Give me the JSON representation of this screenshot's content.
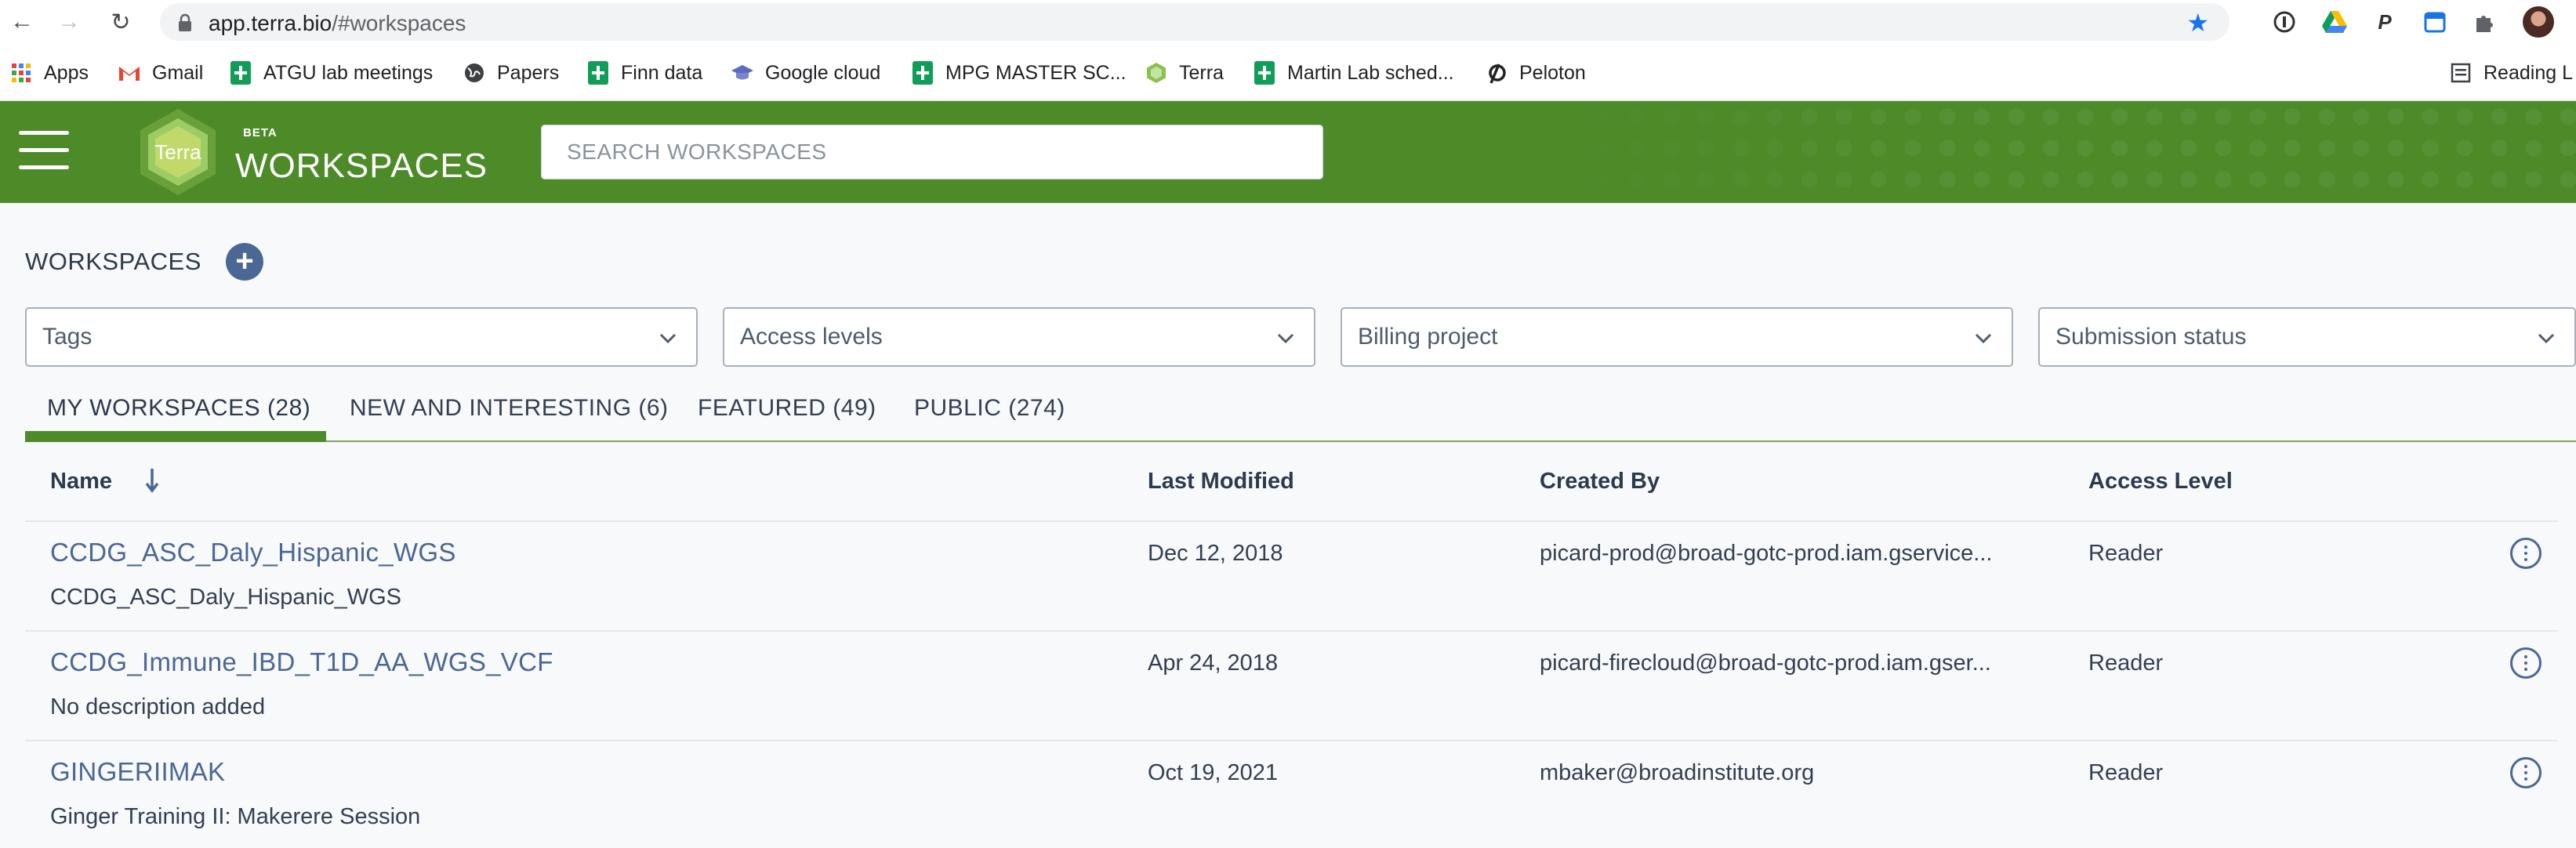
{
  "browser": {
    "url_host": "app.terra.bio",
    "url_path": "/#workspaces",
    "bookmarks": [
      {
        "label": "Apps",
        "icon": "apps-grid-icon"
      },
      {
        "label": "Gmail",
        "icon": "gmail-icon"
      },
      {
        "label": "ATGU lab meetings",
        "icon": "sheets-icon"
      },
      {
        "label": "Papers",
        "icon": "globe-icon"
      },
      {
        "label": "Finn data",
        "icon": "sheets-icon"
      },
      {
        "label": "Google cloud",
        "icon": "mortarboard-icon"
      },
      {
        "label": "MPG MASTER SC...",
        "icon": "sheets-icon"
      },
      {
        "label": "Terra",
        "icon": "terra-icon"
      },
      {
        "label": "Martin Lab sched...",
        "icon": "sheets-icon"
      },
      {
        "label": "Peloton",
        "icon": "peloton-icon"
      }
    ],
    "reading_list": "Reading L"
  },
  "header": {
    "beta": "BETA",
    "title": "WORKSPACES",
    "logo_text": "Terra",
    "search_placeholder": "SEARCH WORKSPACES"
  },
  "main": {
    "title": "WORKSPACES",
    "add_symbol": "+",
    "filters": [
      "Tags",
      "Access levels",
      "Billing project",
      "Submission status"
    ],
    "tabs": [
      {
        "label": "MY WORKSPACES (28)",
        "active": true
      },
      {
        "label": "NEW AND INTERESTING (6)",
        "active": false
      },
      {
        "label": "FEATURED (49)",
        "active": false
      },
      {
        "label": "PUBLIC (274)",
        "active": false
      }
    ],
    "columns": {
      "name": "Name",
      "last_modified": "Last Modified",
      "created_by": "Created By",
      "access_level": "Access Level"
    },
    "rows": [
      {
        "name": "CCDG_ASC_Daly_Hispanic_WGS",
        "description": "CCDG_ASC_Daly_Hispanic_WGS",
        "last_modified": "Dec 12, 2018",
        "created_by": "picard-prod@broad-gotc-prod.iam.gservice...",
        "access_level": "Reader"
      },
      {
        "name": "CCDG_Immune_IBD_T1D_AA_WGS_VCF",
        "description": "No description added",
        "last_modified": "Apr 24, 2018",
        "created_by": "picard-firecloud@broad-gotc-prod.iam.gser...",
        "access_level": "Reader"
      },
      {
        "name": "GINGERIIMAK",
        "description": "Ginger Training II: Makerere Session",
        "last_modified": "Oct 19, 2021",
        "created_by": "mbaker@broadinstitute.org",
        "access_level": "Reader"
      }
    ]
  },
  "colors": {
    "header_green": "#4d8a28",
    "link_blue": "#4b6795",
    "text_dark": "#333f52"
  }
}
